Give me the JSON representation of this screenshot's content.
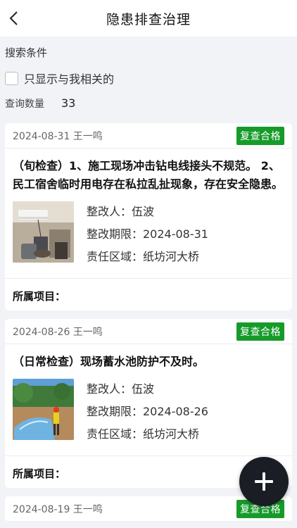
{
  "header": {
    "title": "隐患排查治理"
  },
  "search": {
    "label": "搜索条件",
    "only_mine_label": "只显示与我相关的",
    "only_mine_checked": false,
    "count_label": "查询数量",
    "count_value": "33"
  },
  "records": [
    {
      "date_author": "2024-08-31 王一鸣",
      "status": "复查合格",
      "description": "（旬检查）1、施工现场冲击钻电线接头不规范。 2、民工宿舍临时用电存在私拉乱扯现象，存在安全隐患。",
      "rectifier": "整改人：伍波",
      "deadline": "整改期限：2024-08-31",
      "area": "责任区域：纸坊河大桥",
      "project_label": "所属项目："
    },
    {
      "date_author": "2024-08-26 王一鸣",
      "status": "复查合格",
      "description": "（日常检查）现场蓄水池防护不及时。",
      "rectifier": "整改人：伍波",
      "deadline": "整改期限：2024-08-26",
      "area": "责任区域：纸坊河大桥",
      "project_label": "所属项目："
    },
    {
      "date_author": "2024-08-19 王一鸣",
      "status": "复查合格"
    }
  ],
  "colors": {
    "status_badge": "#169b2a",
    "fab": "#1a1d24",
    "page_bg": "#f2f3f7"
  },
  "icons": {
    "back": "chevron-left-icon",
    "add": "plus-icon"
  }
}
